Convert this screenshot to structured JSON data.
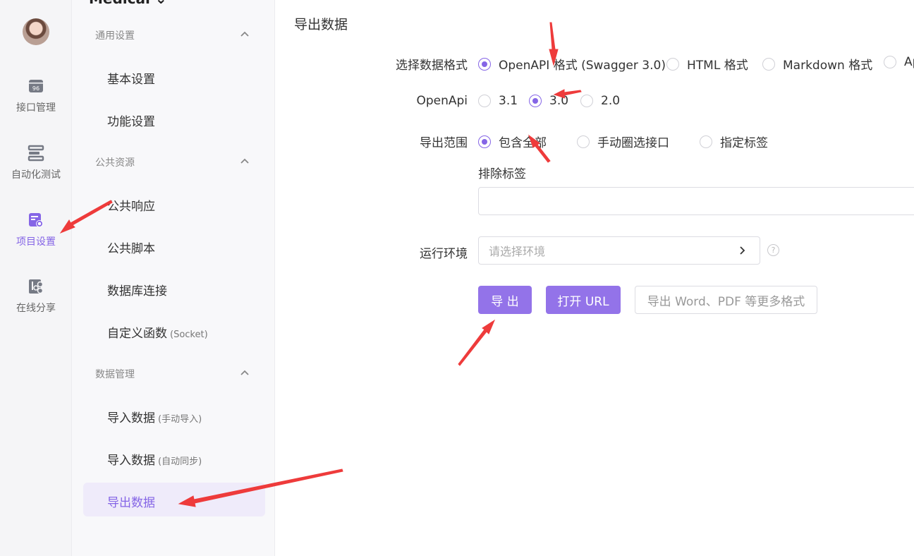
{
  "project_name": "Medical",
  "rail": [
    {
      "label": "接口管理",
      "icon": "api-icon"
    },
    {
      "label": "自动化测试",
      "icon": "automation-icon"
    },
    {
      "label": "项目设置",
      "icon": "project-settings-icon"
    },
    {
      "label": "在线分享",
      "icon": "share-icon"
    }
  ],
  "sidebar": {
    "groups": [
      "通用设置",
      "公共资源",
      "数据管理"
    ],
    "items": [
      {
        "label": "基本设置"
      },
      {
        "label": "功能设置"
      },
      {
        "label": "公共响应"
      },
      {
        "label": "公共脚本"
      },
      {
        "label": "数据库连接"
      },
      {
        "label": "自定义函数",
        "note": "(Socket)"
      },
      {
        "label": "导入数据",
        "note": "(手动导入)"
      },
      {
        "label": "导入数据",
        "note": "(自动同步)"
      },
      {
        "label": "导出数据"
      }
    ]
  },
  "main": {
    "title": "导出数据",
    "format_label": "选择数据格式",
    "formats": [
      "OpenAPI 格式 (Swagger 3.0)",
      "HTML 格式",
      "Markdown 格式",
      "Ap"
    ],
    "openapi_label": "OpenApi",
    "versions": [
      "3.1",
      "3.0",
      "2.0"
    ],
    "scope_label": "导出范围",
    "scopes": [
      "包含全部",
      "手动圈选接口",
      "指定标签"
    ],
    "exclude_label": "排除标签",
    "env_label": "运行环境",
    "env_placeholder": "请选择环境",
    "help": "?",
    "buttons": {
      "export": "导 出",
      "open_url": "打开 URL",
      "more": "导出 Word、PDF 等更多格式"
    }
  },
  "colors": {
    "accent": "#8565e6",
    "annotation": "#ee3b3b"
  }
}
